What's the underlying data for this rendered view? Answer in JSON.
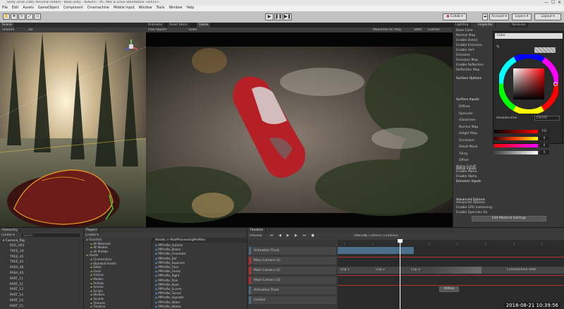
{
  "titlebar": {
    "title": "Unity 2018.3.0b5 Personal (64bit) - Book.unity - Autumn - PC, Mac & Linux Standalone <DX11>"
  },
  "menu": [
    "File",
    "Edit",
    "Assets",
    "GameObject",
    "Component",
    "Cinemachine",
    "Mobile Input",
    "Window",
    "Tools",
    "Window",
    "Help"
  ],
  "toolbar": {
    "collab": "Collab ▾",
    "account": "Account ▾",
    "layers": "Layers ▾",
    "layout": "Layout ▾"
  },
  "scene": {
    "tab": "Scene",
    "shading": "Shaded",
    "mode": "2D"
  },
  "game": {
    "tab_animator": "Animator",
    "tab_asset_store": "Asset Store",
    "tab_game": "Game",
    "aspect": "Free Aspect",
    "scale": "Scale",
    "maximize": "Maximize On Play",
    "stats": "Stats",
    "gizmos": "Gizmos"
  },
  "inspector": {
    "tab_lighting": "Lighting",
    "tab_inspector": "Inspector",
    "tab_services": "Services",
    "rows": [
      "Base Color",
      "Normal Map",
      "Enable Detail",
      "Enable Emission",
      "Enable Vert",
      "Emission",
      "Emission Map",
      "Enable Reflection",
      "Reflection Map",
      "Alpha Cutoff",
      "Enable Alpha",
      "Enable Alpha",
      "Advanced Options",
      "Enable GPU Instancing",
      "Enable Specular Ha"
    ],
    "sections": [
      "Surface Options",
      "Surface Inputs",
      "Detail Inputs",
      "Emission Inputs",
      "Advanced Options"
    ],
    "labels": [
      "Diffuse",
      "Specular",
      "Glossiness",
      "Normal Map",
      "Height Map",
      "Occlusion",
      "Detail Mask",
      "Tiling",
      "Offset"
    ],
    "color_name": "Color",
    "hex_label": "Hexadecimal",
    "hex_value": "FFFFFF",
    "material_button": "Edit Material Settings",
    "color_values": [
      "255",
      "0",
      "0",
      "0"
    ]
  },
  "hierarchy": {
    "tab": "Hierarchy",
    "create": "Create ▾",
    "search": "Search",
    "root": "Camera_Rig",
    "items": [
      "ROC_001",
      "TREE_14",
      "TREE_45",
      "TREE_41",
      "PARA_46",
      "PARA_45",
      "PART_11",
      "PART_11",
      "PART_12",
      "PART_14",
      "PART_14",
      "PART_15"
    ]
  },
  "project": {
    "tab": "Project",
    "create": "Create ▾",
    "breadcrumb": "Assets > PostProcessingProfiles",
    "folders": [
      "Favorites",
      "All Materials",
      "All Models",
      "All Prefabs",
      "Assets",
      "Cinemachine",
      "Standard Assets",
      "Editor",
      "Fonts",
      "Gizmos",
      "Models",
      "Prefabs",
      "Scenes",
      "Scripts",
      "Shaders",
      "Sounds",
      "Textures",
      "Timeline"
    ],
    "files": [
      "PPProfile_Autumn",
      "PPProfile_Bloom",
      "PPProfile_Cinematic",
      "PPProfile_Dof",
      "PPProfile_Exposure",
      "PPProfile_Final",
      "PPProfile_Forest",
      "PPProfile_Night",
      "PPProfile_Rain",
      "PPProfile_Road",
      "PPProfile_Sunset",
      "PPProfile_Tunnel",
      "PPProfile_Vignette",
      "PPProfile_Water",
      "PPProfile_Winter"
    ]
  },
  "timeline": {
    "tab": "Timeline",
    "header": "TIMELINE Camera (Timeline)",
    "preview": "Preview",
    "tracks": [
      "Animation Track",
      "Main Camera (1)",
      "Main Camera (2)",
      "Main Camera (3)",
      "Activation Track",
      "Control"
    ],
    "clip1": "Clip 1",
    "clip2": "Clip 2",
    "clip3": "Clip 3",
    "clip_end": "Cinemachine Shot",
    "active": "Active"
  },
  "overlay": {
    "timestamp": "2018-08-21  10:39:56"
  },
  "colors": {
    "accent": "#3e7bd6",
    "record": "#b83030",
    "timeline_clip": "#4a6e8a",
    "car": "#b52027"
  }
}
